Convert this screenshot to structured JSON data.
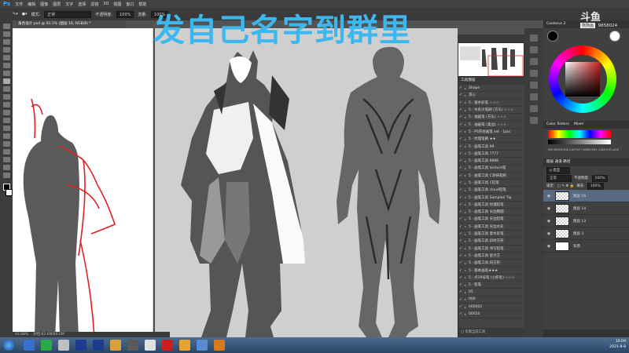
{
  "app": {
    "logo": "Ps"
  },
  "menu": [
    "文件",
    "编辑",
    "图像",
    "图层",
    "文字",
    "选择",
    "滤镜",
    "3D",
    "视图",
    "窗口",
    "帮助"
  ],
  "options": {
    "mode_label": "模式:",
    "mode_value": "正常",
    "opacity_label": "不透明度:",
    "opacity_value": "100%",
    "flow_label": "流量:",
    "flow_value": "100%"
  },
  "document": {
    "tab": "角色设计.psd @ 92.1% (图层 16, RGB/8) *"
  },
  "overlay_title": "发自己名字到群里",
  "watermark": {
    "logo": "斗鱼",
    "sub": "熊熊画",
    "room": "9858024"
  },
  "status": {
    "zoom": "92.08%",
    "doc": "文档:83.6M/84.0M"
  },
  "actions_panel": {
    "tab": "工具预设",
    "items": [
      "Shape",
      "其心",
      "5 · 速水彩笔 ☆☆☆",
      "5 · 水彩大笔刷 (方头) ☆☆☆",
      "5 · 油画笔 (方头) ☆☆☆",
      "5 · 油画笔 (柔边) ☆☆☆",
      "5 · PS伤仿画笔 set · 1pix",
      "5 · 纹理笔刷 ★★",
      "5 · 画笔工具 99",
      "5 · 画笔工具 7777",
      "5 · 画笔工具 8888",
      "5 · 画笔工具 texture笔",
      "5 · 画笔工具 C涂抹笔刷",
      "5 · 画笔工具 C铅笔",
      "5 · 画笔工具 cloud铅笔",
      "5 · 画笔工具 Sampled Tip",
      "5 · 画笔工具 纹理铅笔",
      "5 · 画笔工具 尖边椭圆",
      "5 · 画笔工具 尖边铅笔",
      "5 · 画笔工具 尖边水彩",
      "5 · 画笔工具 意水彩笔",
      "5 · 画笔工具 斜纹方形",
      "5 · 画笔工具 书写铅笔",
      "5 · 画笔工具 星点方",
      "5 · 画笔工具 斜方形",
      "5 · 基本画笔★★★",
      "5 · 点19号笔 (小织毛) ☆☆☆",
      "5 · 铅笔",
      "05",
      "000",
      "000002",
      "00024"
    ],
    "footer": "□ 仅限当前工具"
  },
  "color_panel": {
    "tab": "Coolorus 2"
  },
  "swatches_panel": {
    "tabs": [
      "Color Sliders",
      "Mixer"
    ],
    "buttons": "BW  BRUSHHE  LAYOUT  HARMONY  CAMOUFLAGE"
  },
  "layers_panel": {
    "tabs": "图层  通道  路径",
    "kind": "ρ 类型",
    "blend": "正常",
    "opacity_label": "不透明度:",
    "opacity": "100%",
    "lock_label": "锁定:",
    "fill_label": "填充:",
    "fill": "100%",
    "layers": [
      {
        "name": "图层 16",
        "selected": true,
        "thumb": "check"
      },
      {
        "name": "图层 14",
        "selected": false,
        "thumb": "check"
      },
      {
        "name": "图层 13",
        "selected": false,
        "thumb": "check"
      },
      {
        "name": "图层 3",
        "selected": false,
        "thumb": "check"
      },
      {
        "name": "背景",
        "selected": false,
        "thumb": "white"
      }
    ]
  },
  "taskbar": {
    "time": "10:09",
    "date": "2021-8-8",
    "icons": [
      "#3a6fcf",
      "#2aa84a",
      "#c0c0c0",
      "#1d3c8f",
      "#1d3c8f",
      "#d9a13c",
      "#5a5a5a",
      "#e0e0e0",
      "#c91f1f",
      "#e8a22e",
      "#5a8ad6",
      "#d97a1a"
    ]
  }
}
